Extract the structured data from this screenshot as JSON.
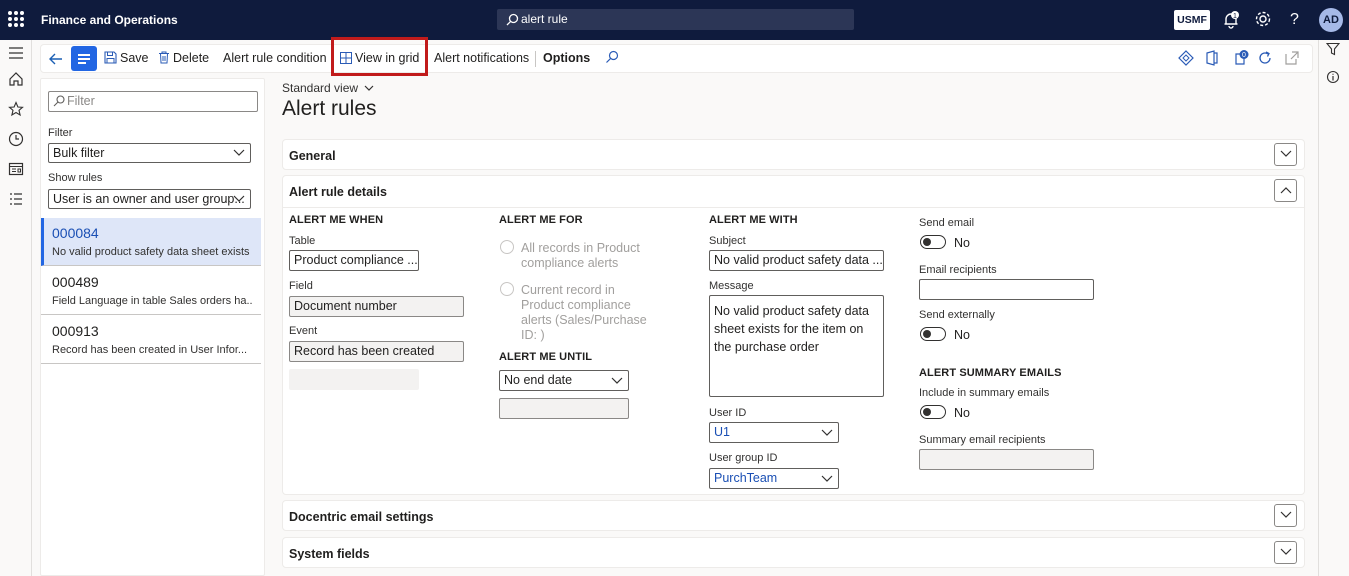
{
  "topbar": {
    "app_title": "Finance and Operations",
    "search_value": "alert rule",
    "company": "USMF",
    "notification_count": "1",
    "user_initials": "AD"
  },
  "actions": {
    "save": "Save",
    "delete": "Delete",
    "alert_rule_condition": "Alert rule condition",
    "view_in_grid": "View in grid",
    "alert_notifications": "Alert notifications",
    "options": "Options",
    "badge_count": "0"
  },
  "listpanel": {
    "filter_placeholder": "Filter",
    "filter_label": "Filter",
    "filter_value": "Bulk filter",
    "show_rules_label": "Show rules",
    "show_rules_value": "User is an owner and user group...",
    "items": [
      {
        "id": "000084",
        "desc": "No valid product safety data sheet exists"
      },
      {
        "id": "000489",
        "desc": "Field Language in table Sales orders ha..."
      },
      {
        "id": "000913",
        "desc": "Record has been created in User Infor..."
      }
    ]
  },
  "page": {
    "view_name": "Standard view",
    "title": "Alert rules"
  },
  "fasttabs": {
    "general": "General",
    "details": "Alert rule details",
    "docentric": "Docentric email settings",
    "system": "System fields"
  },
  "alert_me_when": {
    "header": "ALERT ME WHEN",
    "table_label": "Table",
    "table_value": "Product compliance ...",
    "field_label": "Field",
    "field_value": "Document number",
    "event_label": "Event",
    "event_value": "Record has been created"
  },
  "alert_me_for": {
    "header": "ALERT ME FOR",
    "option1": "All records in Product compliance alerts",
    "option2": "Current record in Product compliance alerts (Sales/Purchase ID: )"
  },
  "alert_me_until": {
    "header": "ALERT ME UNTIL",
    "value": "No end date"
  },
  "alert_me_with": {
    "header": "ALERT ME WITH",
    "subject_label": "Subject",
    "subject_value": "No valid product safety data ...",
    "message_label": "Message",
    "message_value": "No valid product safety data sheet exists for the item on the purchase order",
    "user_id_label": "User ID",
    "user_id_value": "U1",
    "user_group_label": "User group ID",
    "user_group_value": "PurchTeam"
  },
  "email": {
    "send_email_label": "Send email",
    "send_email_value": "No",
    "recipients_label": "Email recipients",
    "send_externally_label": "Send externally",
    "send_externally_value": "No",
    "summary_header": "ALERT SUMMARY EMAILS",
    "include_summary_label": "Include in summary emails",
    "include_summary_value": "No",
    "summary_recipients_label": "Summary email recipients"
  },
  "colors": {
    "topbar": "#0f1b3d",
    "accent": "#2266e3",
    "highlight": "#c11b1b"
  }
}
